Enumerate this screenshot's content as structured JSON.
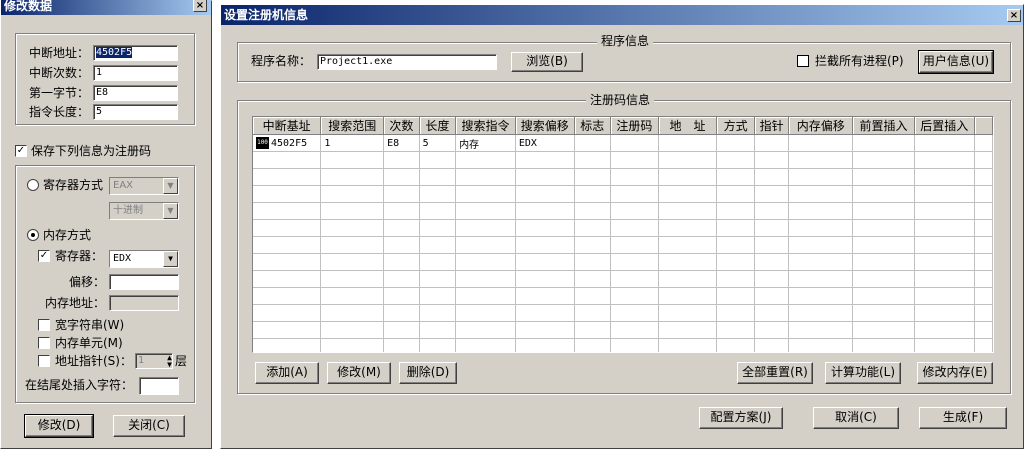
{
  "left": {
    "title": "修改数据",
    "close": "×",
    "fields": [
      {
        "label": "中断地址：",
        "value": "4502F5"
      },
      {
        "label": "中断次数：",
        "value": "1"
      },
      {
        "label": "第一字节：",
        "value": "E8"
      },
      {
        "label": "指令长度：",
        "value": "5"
      }
    ],
    "save_checkbox": "保存下列信息为注册码",
    "register_mode": "寄存器方式",
    "register_combo": "EAX",
    "radix_combo": "十进制",
    "memory_mode": "内存方式",
    "register_label": "寄存器：",
    "register_value": "EDX",
    "offset_label": "偏移：",
    "offset_value": "",
    "memaddr_label": "内存地址：",
    "memaddr_value": "",
    "widechar": "宽字符串(W)",
    "memunit": "内存单元(M)",
    "addrptr": "地址指针(S)：",
    "addrptr_value": "1",
    "addrptr_suffix": "层",
    "insert_label": "在结尾处插入字符：",
    "insert_value": "",
    "btn_modify": "修改(D)",
    "btn_close": "关闭(C)"
  },
  "right": {
    "title": "设置注册机信息",
    "close": "×",
    "program_group": "程序信息",
    "program_label": "程序名称：",
    "program_value": "Project1.exe",
    "btn_browse": "浏览(B)",
    "intercept": "拦截所有进程(P)",
    "btn_userinfo": "用户信息(U)",
    "regcode_group": "注册码信息",
    "columns": [
      "中断基址",
      "搜索范围",
      "次数",
      "长度",
      "搜索指令",
      "搜索偏移",
      "标志",
      "注册码",
      "地　址",
      "方式",
      "指针",
      "内存偏移",
      "前置插入",
      "后置插入",
      ""
    ],
    "rows": [
      [
        "4502F5",
        "1",
        "E8",
        "5",
        "内存",
        "EDX",
        "",
        "",
        "",
        "",
        "",
        "",
        "",
        "",
        ""
      ]
    ],
    "row_icon": "100",
    "btn_add": "添加(A)",
    "btn_modify": "修改(M)",
    "btn_delete": "删除(D)",
    "btn_resetall": "全部重置(R)",
    "btn_calc": "计算功能(L)",
    "btn_modmem": "修改内存(E)",
    "btn_config": "配置方案(J)",
    "btn_cancel": "取消(C)",
    "btn_generate": "生成(F)"
  },
  "colors": {
    "face": "#d4d0c8",
    "title_from": "#0a246a",
    "title_to": "#a6caf0"
  }
}
